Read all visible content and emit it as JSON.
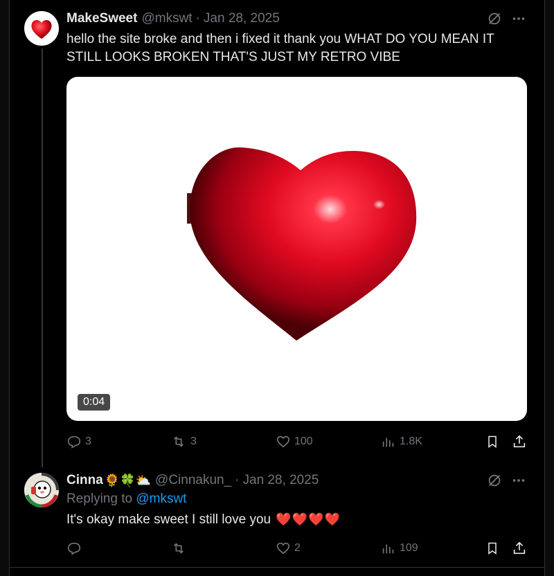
{
  "colors": {
    "background": "#000000",
    "text": "#e7e9ea",
    "muted": "#71767b",
    "link": "#1d9bf0",
    "heart": "#e8132f"
  },
  "tweet": {
    "name": "MakeSweet",
    "handle": "@mkswt",
    "date": "Jan 28, 2025",
    "text_line1": "hello the site broke and then i fixed it thank you WHAT DO YOU MEAN IT",
    "text_line2": "STILL LOOKS BROKEN THAT'S JUST MY RETRO VIBE",
    "video_duration": "0:04",
    "replies": "3",
    "reposts": "3",
    "likes": "100",
    "views": "1.8K"
  },
  "reply": {
    "name": "Cinna",
    "name_emojis": "🌻🍀⛅",
    "handle": "@Cinnakun_",
    "date": "Jan 28, 2025",
    "replying_prefix": "Replying to",
    "replying_to": "@mkswt",
    "text": "It's okay make sweet I still love you",
    "text_emojis": "❤️❤️❤️❤️",
    "replies": "",
    "reposts": "",
    "likes": "2",
    "views": "109"
  },
  "icons": [
    "grok-icon",
    "more-icon",
    "reply-icon",
    "repost-icon",
    "like-icon",
    "views-icon",
    "bookmark-icon",
    "share-icon"
  ]
}
